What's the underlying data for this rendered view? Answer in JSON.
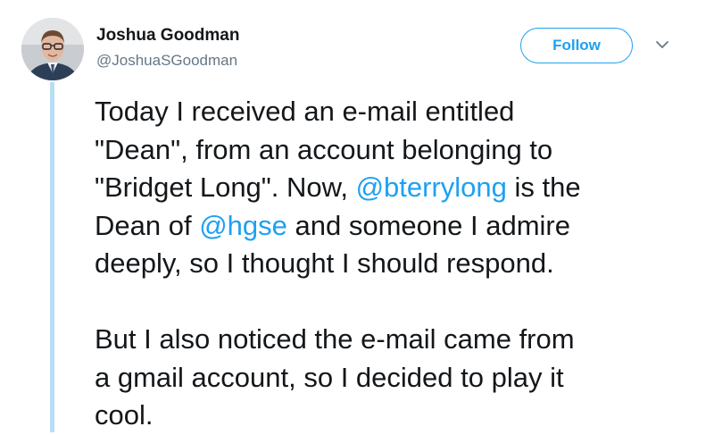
{
  "author": {
    "name": "Joshua Goodman",
    "handle": "@JoshuaSGoodman"
  },
  "follow_label": "Follow",
  "icons": {
    "avatar": "avatar-photo",
    "menu": "chevron-down-icon"
  },
  "colors": {
    "accent": "#1da1f2",
    "thread_line": "#b8def5",
    "text": "#14171a",
    "muted": "#657786"
  },
  "tweet": {
    "p1": {
      "l1": "Today I received an e-mail entitled",
      "l2": "\"Dean\", from an account belonging to",
      "l3_a": "\"Bridget Long\". Now, ",
      "l3_mention": "@bterrylong",
      "l3_b": " is the",
      "l4_a": "Dean of ",
      "l4_mention": "@hgse",
      "l4_b": " and someone I admire",
      "l5": "deeply, so I thought I should respond."
    },
    "p2": {
      "l1": "But I also noticed the e-mail came from",
      "l2": "a gmail account, so I decided to play it",
      "l3": "cool."
    }
  }
}
